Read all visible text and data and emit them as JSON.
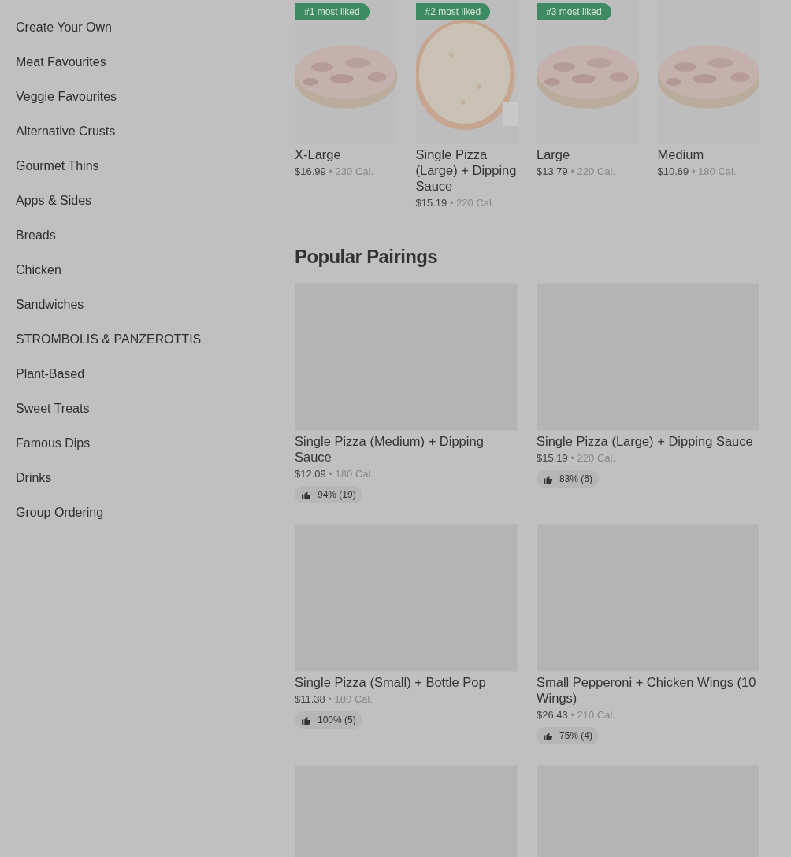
{
  "sidebar": {
    "items": [
      {
        "label": "Create Your Own"
      },
      {
        "label": "Meat Favourites"
      },
      {
        "label": "Veggie Favourites"
      },
      {
        "label": "Alternative Crusts"
      },
      {
        "label": "Gourmet Thins"
      },
      {
        "label": "Apps & Sides"
      },
      {
        "label": "Breads"
      },
      {
        "label": "Chicken"
      },
      {
        "label": "Sandwiches"
      },
      {
        "label": "STROMBOLIS & PANZEROTTIS"
      },
      {
        "label": "Plant-Based"
      },
      {
        "label": "Sweet Treats"
      },
      {
        "label": "Famous Dips"
      },
      {
        "label": "Drinks"
      },
      {
        "label": "Group Ordering"
      }
    ]
  },
  "top_items": [
    {
      "badge": "#1 most liked",
      "name": "X-Large",
      "price": "$16.99",
      "separator": "•",
      "calories": "230 Cal."
    },
    {
      "badge": "#2 most liked",
      "name": "Single Pizza (Large) + Dipping Sauce",
      "price": "$15.19",
      "separator": "•",
      "calories": "220 Cal."
    },
    {
      "badge": "#3 most liked",
      "name": "Large",
      "price": "$13.79",
      "separator": "•",
      "calories": "220 Cal."
    },
    {
      "name": "Medium",
      "price": "$10.69",
      "separator": "•",
      "calories": "180 Cal."
    }
  ],
  "popular_pairings": {
    "title": "Popular Pairings",
    "items": [
      {
        "kind": "item",
        "name": "Single Pizza (Medium) + Dipping Sauce",
        "price": "$12.09",
        "separator": "•",
        "calories": "180 Cal.",
        "rating": "94% (19)"
      },
      {
        "kind": "item",
        "name": "Single Pizza (Large) + Dipping Sauce",
        "price": "$15.19",
        "separator": "•",
        "calories": "220 Cal.",
        "rating": "83% (6)"
      },
      {
        "kind": "item",
        "name": "Single Pizza (Small) + Bottle Pop",
        "price": "$11.38",
        "separator": "•",
        "calories": "180 Cal.",
        "rating": "100% (5)"
      },
      {
        "kind": "item",
        "name": "Small Pepperoni + Chicken Wings (10 Wings)",
        "price": "$26.43",
        "separator": "•",
        "calories": "210 Cal.",
        "rating": "75% (4)"
      },
      {
        "kind": "image_only"
      },
      {
        "kind": "image_only"
      }
    ]
  }
}
